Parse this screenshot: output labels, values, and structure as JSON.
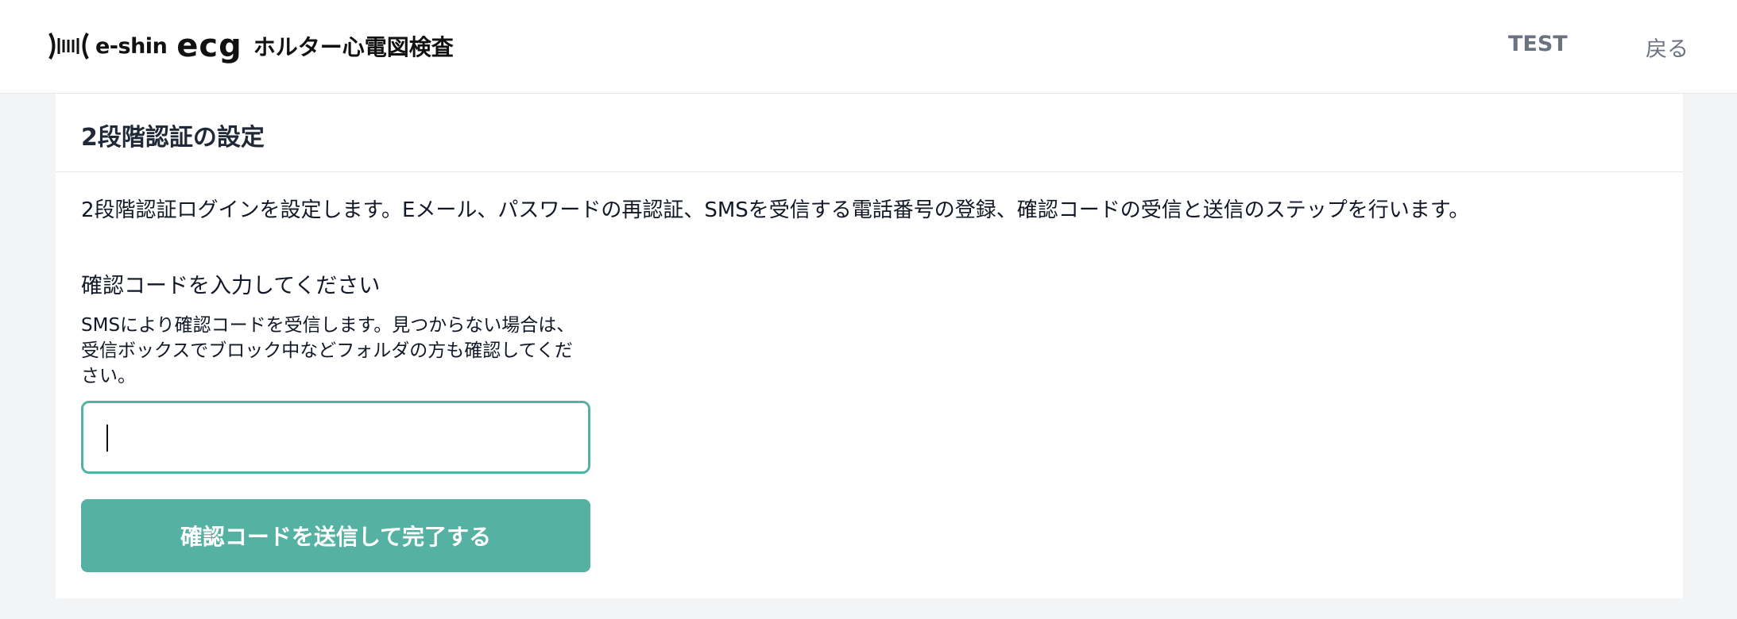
{
  "header": {
    "logo_eshin": "e-shin",
    "logo_ecg": "ecg",
    "logo_title": "ホルター心電図検査",
    "nav_test": "TEST",
    "nav_back": "戻る"
  },
  "card": {
    "title": "2段階認証の設定",
    "description": "2段階認証ログインを設定します。Eメール、パスワードの再認証、SMSを受信する電話番号の登録、確認コードの受信と送信のステップを行います。",
    "code_label": "確認コードを入力してください",
    "help_text": "SMSにより確認コードを受信します。見つからない場合は、受信ボックスでブロック中などフォルダの方も確認してください。",
    "code_input_value": "",
    "submit_label": "確認コードを送信して完了する"
  },
  "colors": {
    "accent": "#55b2a3",
    "nav_text": "#6b7280",
    "background": "#f3f4f6"
  }
}
